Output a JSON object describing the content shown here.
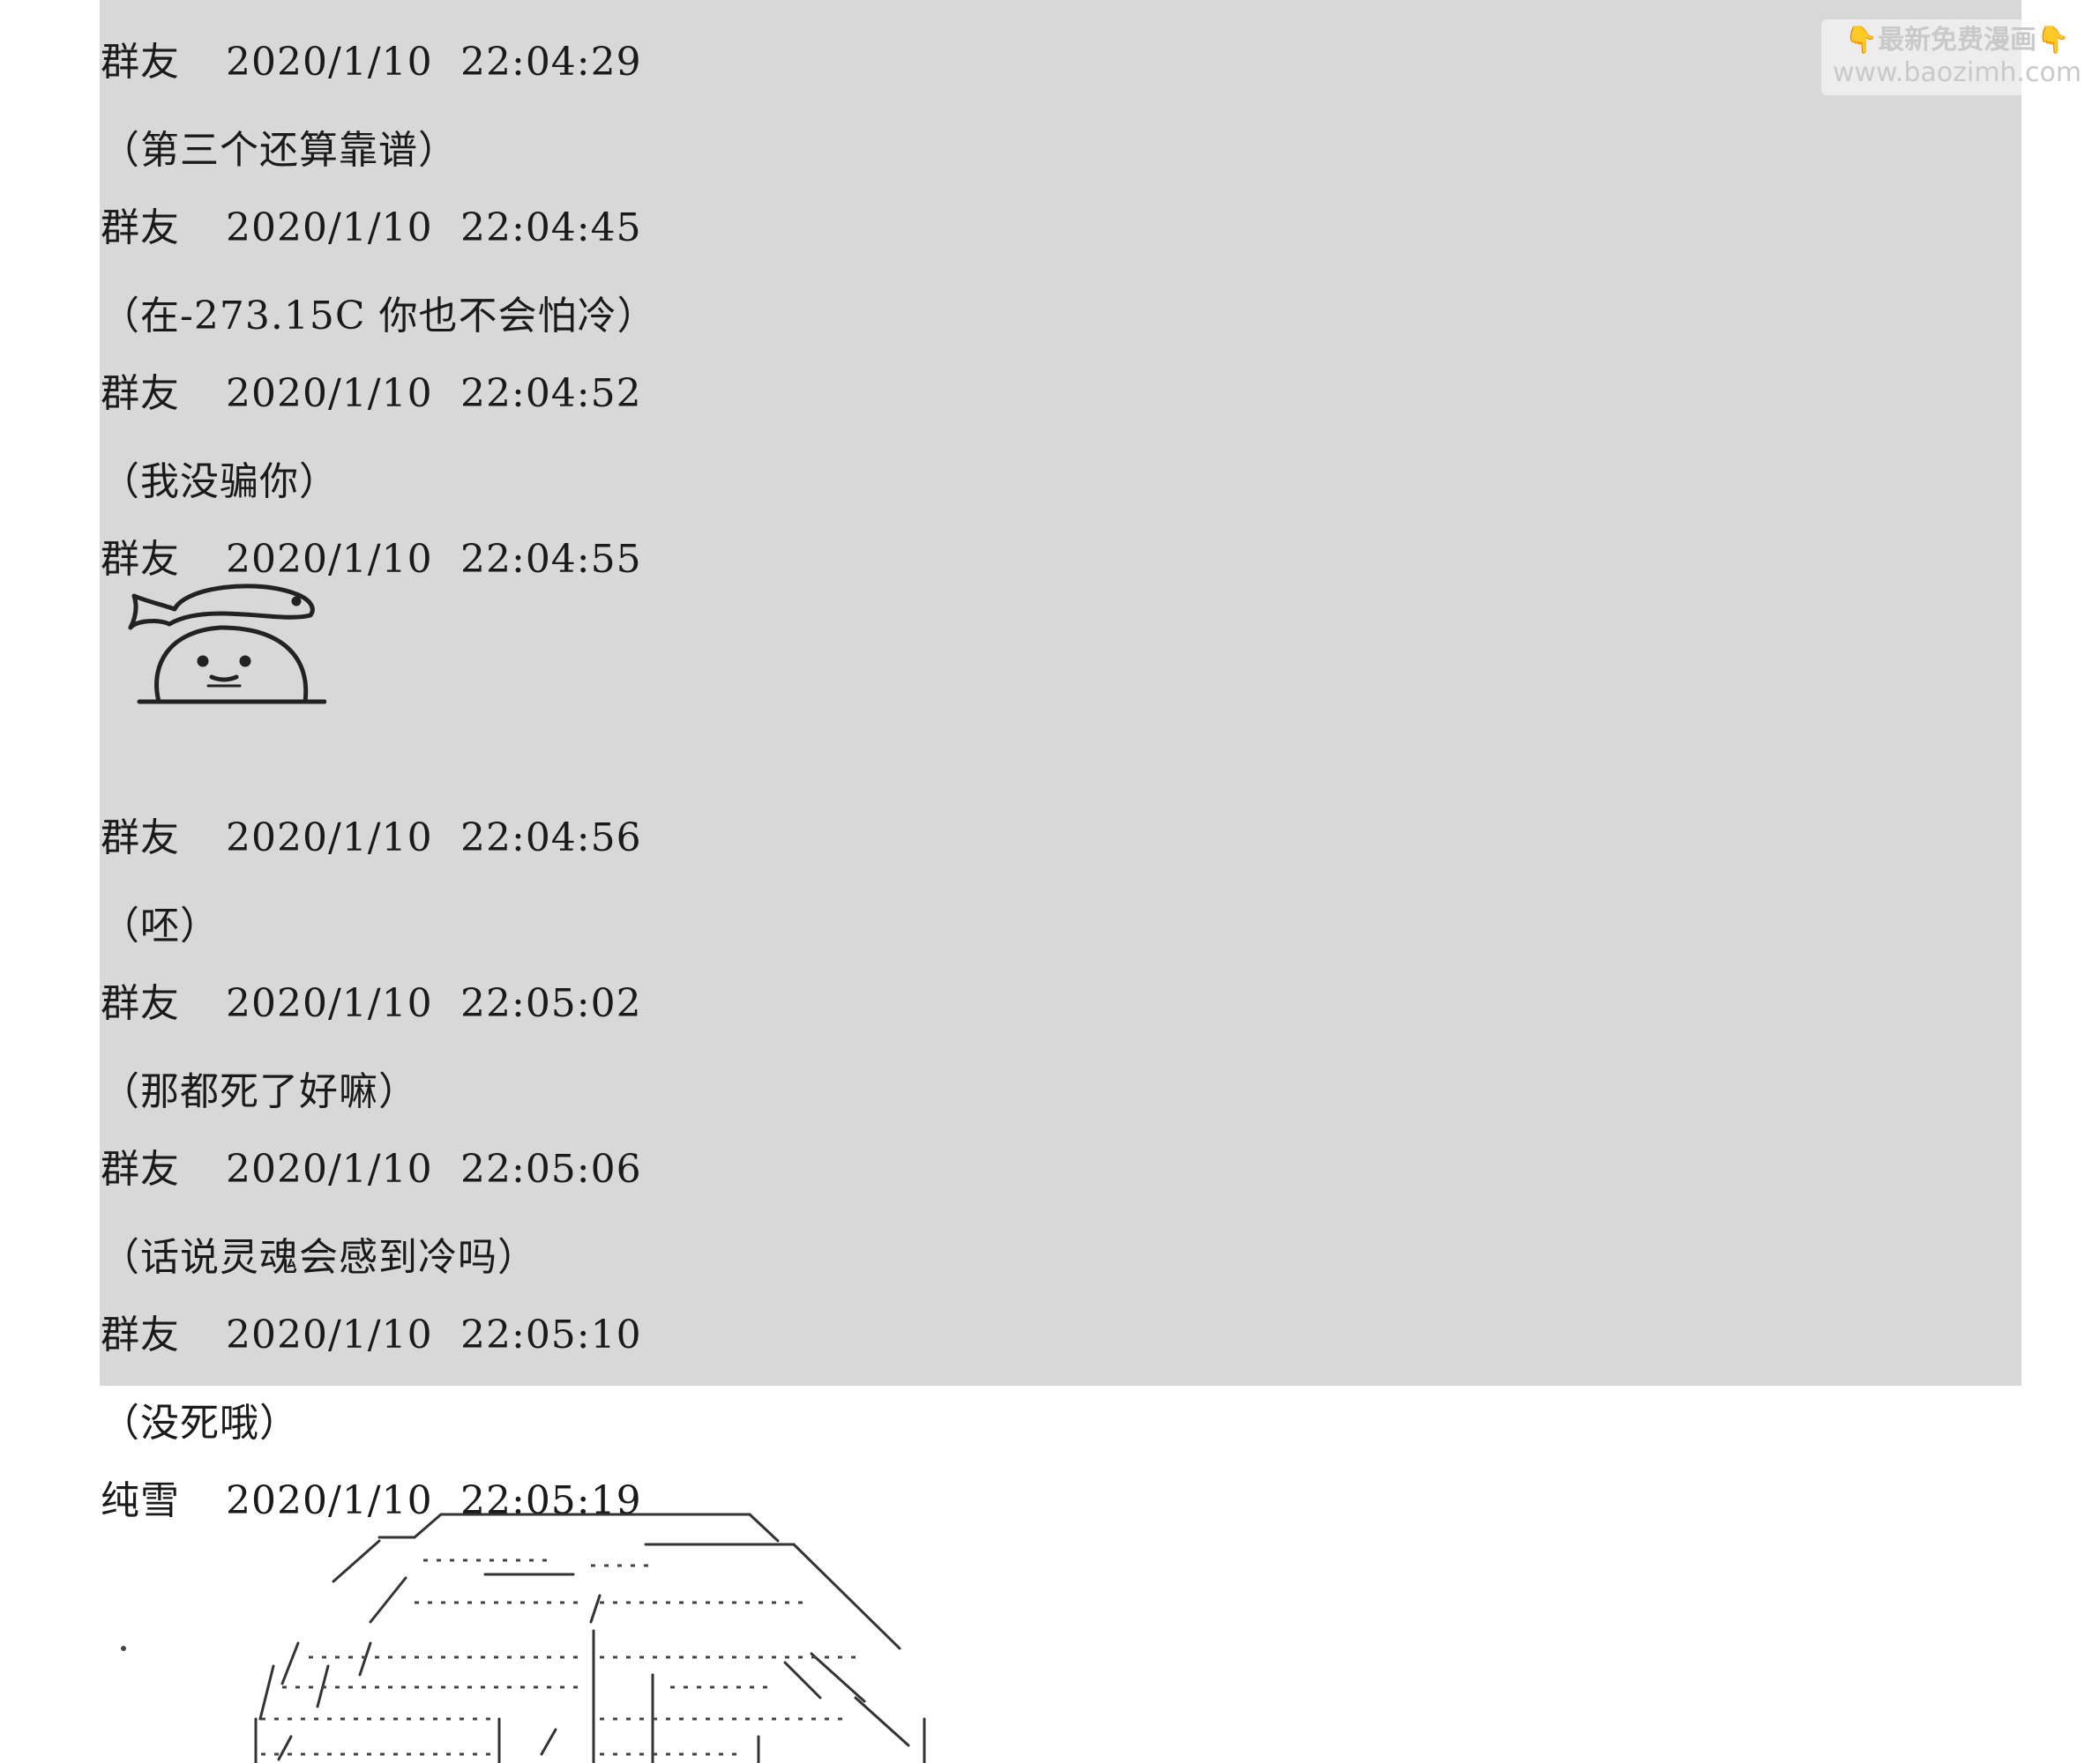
{
  "watermark": {
    "title": "最新免费漫画",
    "hand": "👇",
    "url": "www.baozimh.com"
  },
  "messages": [
    {
      "sender": "群友",
      "date": "2020/1/10",
      "time": "22:04:29",
      "text": "（第三个还算靠谱）"
    },
    {
      "sender": "群友",
      "date": "2020/1/10",
      "time": "22:04:45",
      "text": "（在-273.15C 你也不会怕冷）"
    },
    {
      "sender": "群友",
      "date": "2020/1/10",
      "time": "22:04:52",
      "text": "（我没骗你）"
    },
    {
      "sender": "群友",
      "date": "2020/1/10",
      "time": "22:04:55",
      "text": ""
    },
    {
      "sender": "群友",
      "date": "2020/1/10",
      "time": "22:04:56",
      "text": "（呸）"
    },
    {
      "sender": "群友",
      "date": "2020/1/10",
      "time": "22:05:02",
      "text": "（那都死了好嘛）"
    },
    {
      "sender": "群友",
      "date": "2020/1/10",
      "time": "22:05:06",
      "text": "（话说灵魂会感到冷吗）"
    },
    {
      "sender": "群友",
      "date": "2020/1/10",
      "time": "22:05:10",
      "text": "（没死哦）"
    },
    {
      "sender": "纯雪",
      "date": "2020/1/10",
      "time": "22:05:19",
      "text": ""
    }
  ],
  "colors": {
    "panel": "#d8d8d8",
    "text": "#1a1a1a"
  }
}
